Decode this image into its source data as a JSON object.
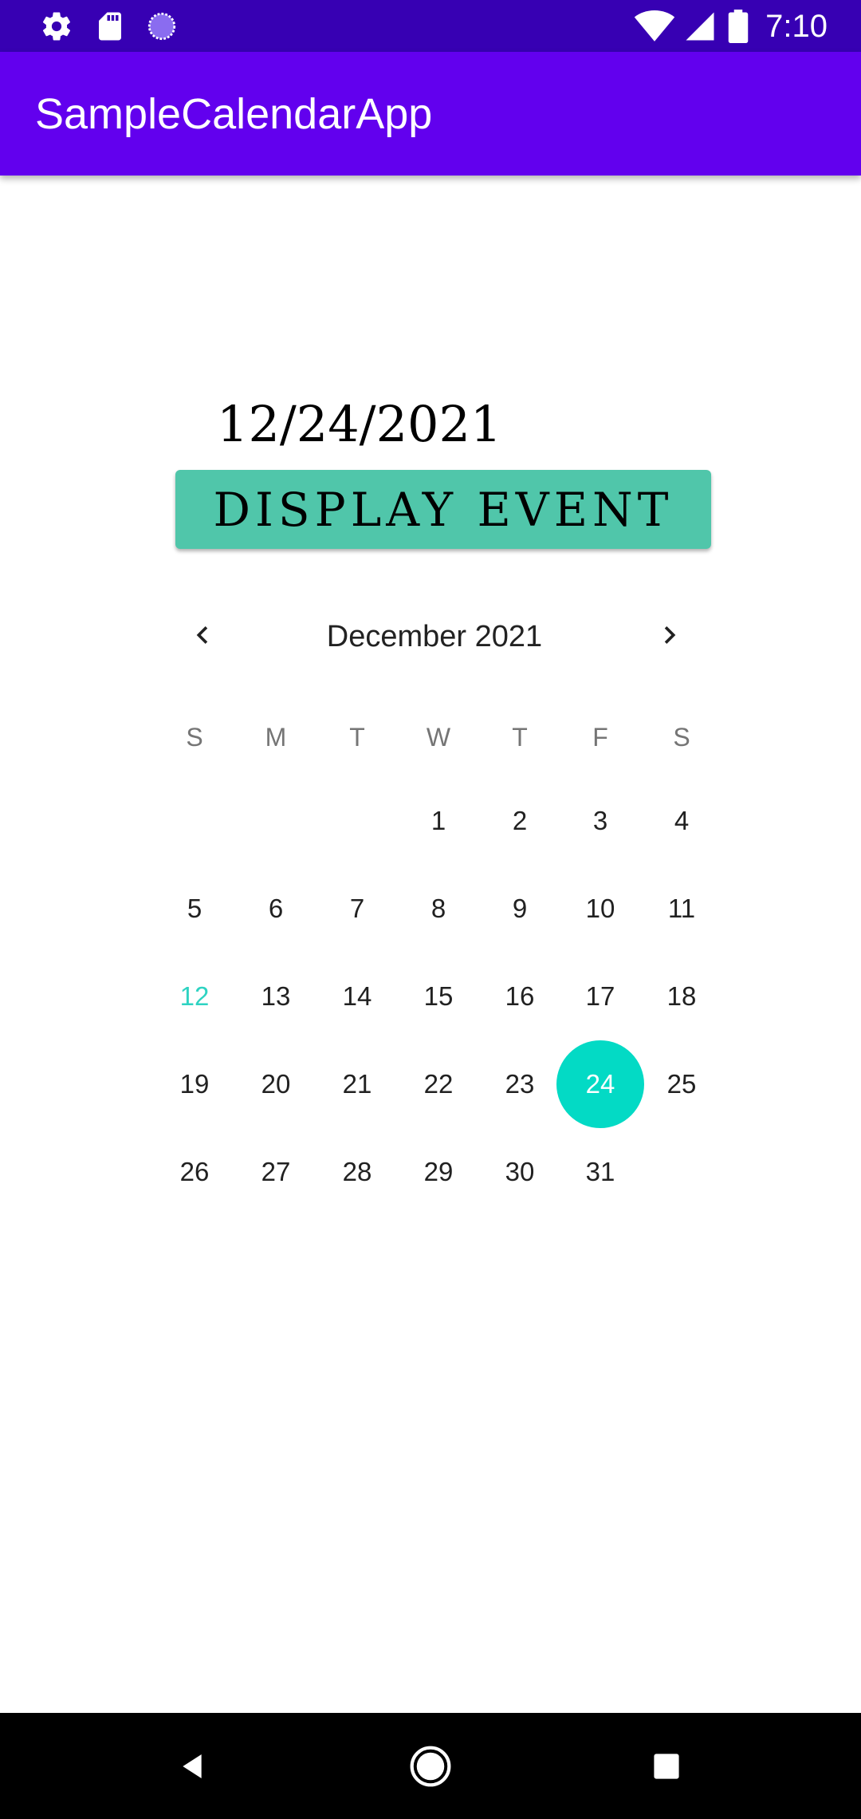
{
  "status_bar": {
    "time": "7:10",
    "left_icons": [
      "settings-icon",
      "sd-card-icon",
      "sync-progress-icon"
    ],
    "right_icons": [
      "wifi-icon",
      "cellular-signal-icon",
      "battery-icon"
    ]
  },
  "app_bar": {
    "title": "SampleCalendarApp",
    "color": "#6200ee"
  },
  "content": {
    "selected_date": "12/24/2021",
    "display_button_label": "DISPLAY EVENT",
    "button_color": "#50c6aa"
  },
  "calendar": {
    "month_label": "December 2021",
    "weekdays": [
      "S",
      "M",
      "T",
      "W",
      "T",
      "F",
      "S"
    ],
    "first_weekday_index": 3,
    "days_in_month": 31,
    "today": 12,
    "selected_day": 24,
    "accent_color": "#03dac5",
    "icons": {
      "prev": "chevron-left-icon",
      "next": "chevron-right-icon"
    }
  },
  "nav_bar": {
    "buttons": [
      "back-icon",
      "home-icon",
      "recents-icon"
    ]
  }
}
